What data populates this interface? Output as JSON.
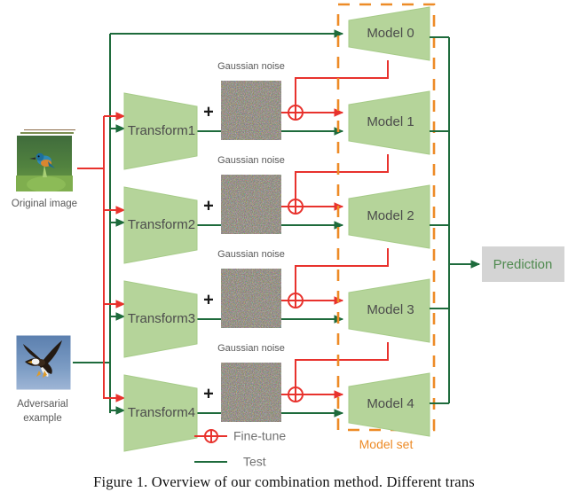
{
  "figure": {
    "caption": "Figure 1. Overview of our combination method. Different trans"
  },
  "inputs": [
    {
      "id": "original",
      "label": "Original image",
      "kind": "image-stack",
      "subject": "kingfisher-bird-photo"
    },
    {
      "id": "adversarial",
      "label": "Adversarial example",
      "kind": "image",
      "subject": "eagle-flying-photo"
    }
  ],
  "transforms": [
    {
      "label": "Transform1"
    },
    {
      "label": "Transform2"
    },
    {
      "label": "Transform3"
    },
    {
      "label": "Transform4"
    }
  ],
  "noise_blocks": [
    {
      "label": "Gaussian noise"
    },
    {
      "label": "Gaussian noise"
    },
    {
      "label": "Gaussian noise"
    },
    {
      "label": "Gaussian noise"
    }
  ],
  "plus_symbol": "+",
  "models": [
    {
      "label": "Model 0"
    },
    {
      "label": "Model 1"
    },
    {
      "label": "Model 2"
    },
    {
      "label": "Model 3"
    },
    {
      "label": "Model 4"
    }
  ],
  "model_set": {
    "label": "Model set"
  },
  "output": {
    "label": "Prediction"
  },
  "legend": {
    "items": [
      {
        "label": "Fine-tune",
        "marker": "circled-plus-on-line",
        "color": "#E8322D"
      },
      {
        "label": "Test",
        "marker": "line",
        "color": "#1E6B3C"
      }
    ]
  },
  "colors": {
    "green_fill": "#B5D49A",
    "green_stroke": "#9CC47E",
    "flow_green": "#1E6B3C",
    "flow_red": "#E8322D",
    "model_set_orange": "#ED8B27",
    "prediction_bg": "#D4D4D4",
    "prediction_text": "#4F8A4F",
    "label_gray": "#595959"
  }
}
